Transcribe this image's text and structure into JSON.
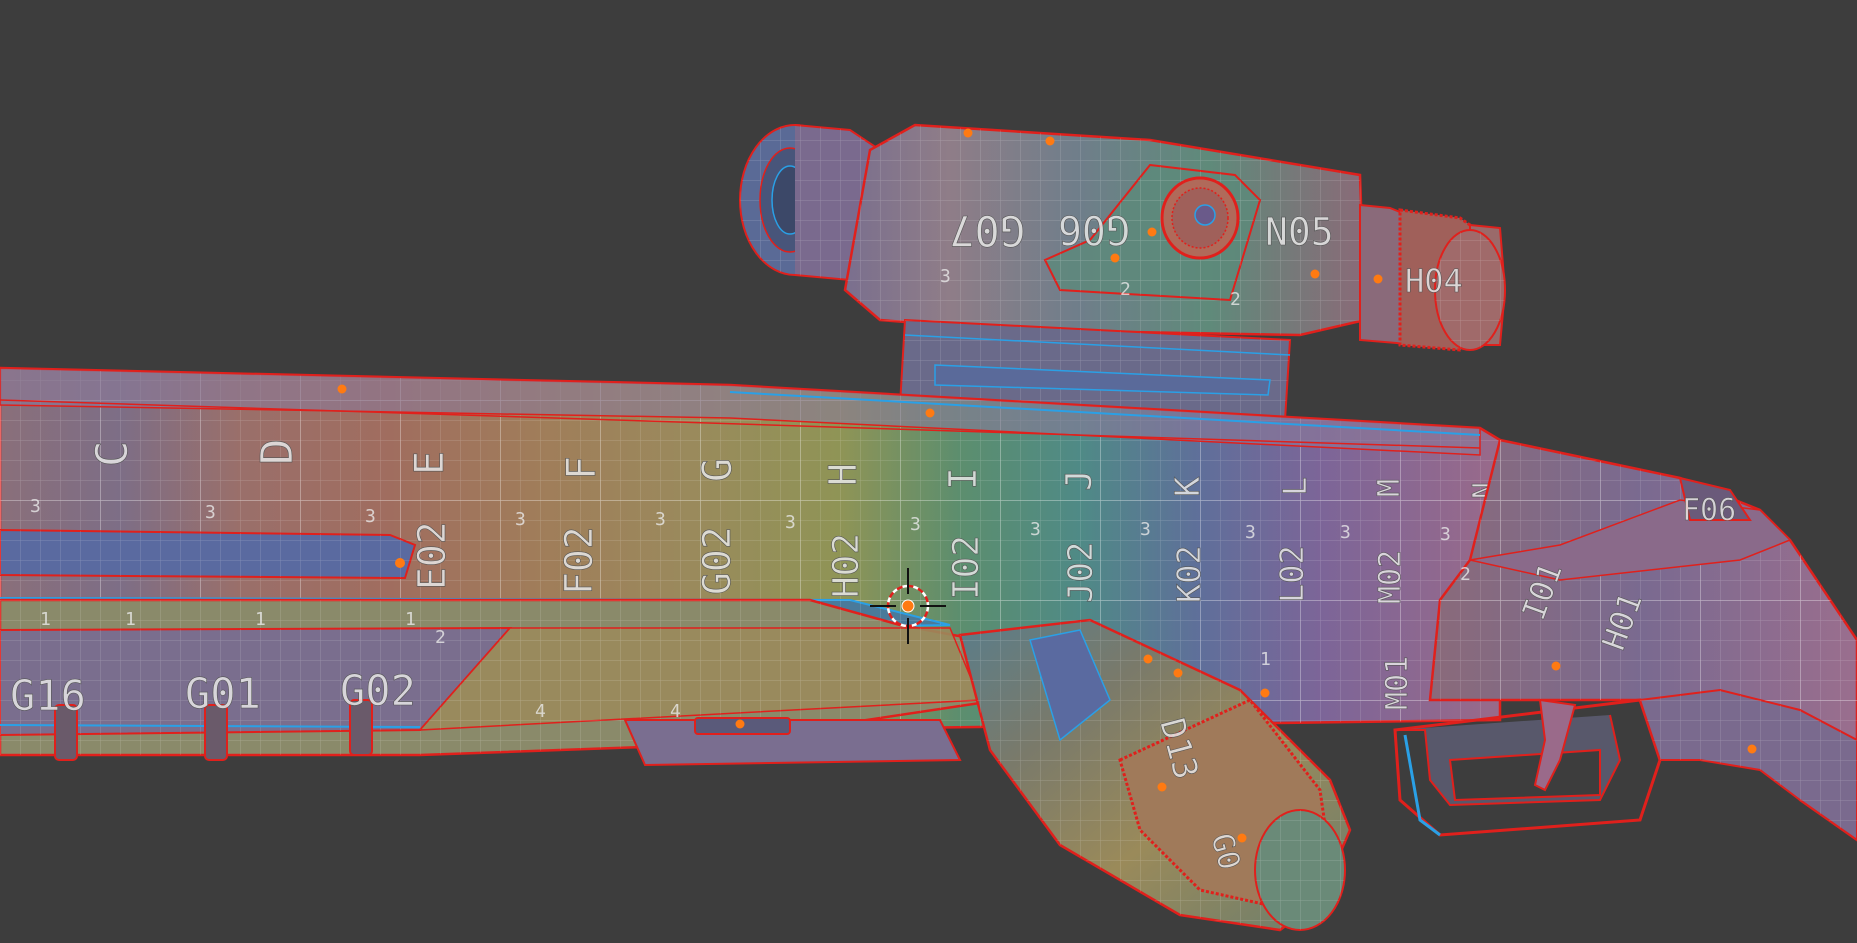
{
  "viewport": {
    "background": "#3d3d3d",
    "selection_outline_color": "#e0201c",
    "active_edge_color": "#2aa0e6",
    "vertex_dot_color": "#ff7a12"
  },
  "uv_labels": {
    "scope": [
      "G07",
      "G06",
      "N05",
      "H04"
    ],
    "scope_small": [
      "3",
      "2",
      "2"
    ],
    "barrel_letters": [
      "C",
      "D",
      "E",
      "F",
      "G",
      "H",
      "I",
      "J",
      "K",
      "L",
      "M",
      "N"
    ],
    "barrel_row2": [
      "E02",
      "F02",
      "G02",
      "H02",
      "I02",
      "J02",
      "K02",
      "L02",
      "M02"
    ],
    "stock_row": [
      "G16",
      "G01",
      "G02"
    ],
    "misc": [
      "F06",
      "I01",
      "H01",
      "M01",
      "D13",
      "G0"
    ],
    "small_numbers": [
      "3",
      "3",
      "3",
      "3",
      "3",
      "3",
      "3",
      "3",
      "3",
      "3",
      "3",
      "3",
      "1",
      "1",
      "1",
      "1",
      "2",
      "4",
      "4",
      "1",
      "2"
    ]
  },
  "cursor": {
    "icon": "3d-cursor-icon"
  }
}
